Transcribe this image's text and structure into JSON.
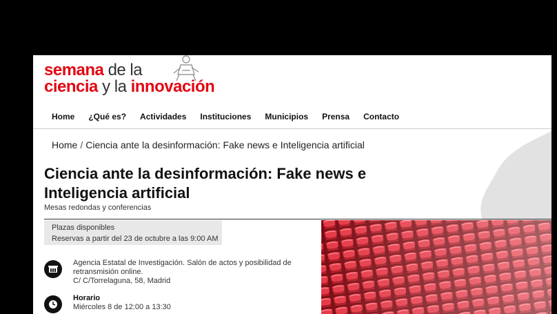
{
  "logo": {
    "line1_bold": "semana",
    "line1_thin": "de la",
    "line2_bold": "ciencia",
    "line2_thin": "y la",
    "line2_bold2": "innovación",
    "brand_color": "#e30613"
  },
  "nav": {
    "items": [
      "Home",
      "¿Qué es?",
      "Actividades",
      "Instituciones",
      "Municipios",
      "Prensa",
      "Contacto"
    ]
  },
  "breadcrumb": {
    "home": "Home",
    "separator": "/",
    "current": "Ciencia ante la desinformación: Fake news e Inteligencia artificial"
  },
  "event": {
    "title": "Ciencia ante la desinformación: Fake news e Inteligencia artificial",
    "category": "Mesas redondas y conferencias",
    "availability": "Plazas disponibles",
    "booking": "Reservas a partir del 23 de octubre a las 9:00 AM",
    "location_line1": "Agencia Estatal de Investigación. Salón de actos y posibilidad de retransmisión online.",
    "location_line2": "C/ C/Torrelaguna, 58, Madrid",
    "schedule_label": "Horario",
    "schedule_value": "Miércoles 8 de 12:00 a 13:30"
  },
  "icons": {
    "location": "building-icon",
    "schedule": "clock-icon"
  }
}
